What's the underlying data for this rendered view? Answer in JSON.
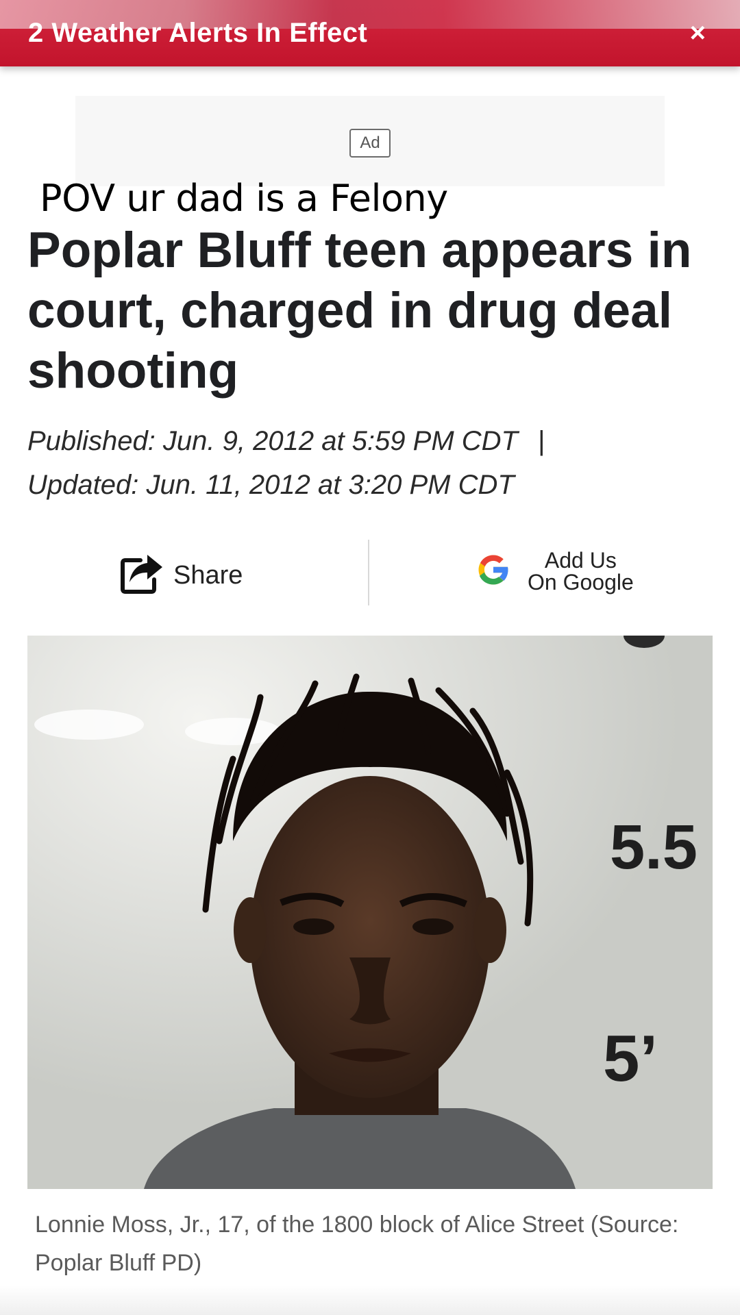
{
  "alert": {
    "text": "2 Weather Alerts In Effect",
    "close_label": "×"
  },
  "ad": {
    "label": "Ad"
  },
  "overlay_caption": "POV ur dad is a Felony",
  "article": {
    "headline": "Poplar Bluff teen appears in court, charged in drug deal shooting",
    "published": "Published: Jun. 9, 2012 at 5:59 PM CDT",
    "separator": "|",
    "updated": "Updated: Jun. 11, 2012 at 3:20 PM CDT"
  },
  "actions": {
    "share_label": "Share",
    "google_line1": "Add Us",
    "google_line2": "On Google"
  },
  "photo": {
    "wall_marking_top": "5.5",
    "wall_marking_bottom": "5’",
    "caption": "Lonnie Moss, Jr., 17, of the 1800 block of Alice Street (Source: Poplar Bluff PD)"
  },
  "colors": {
    "alert_red": "#c8182f",
    "headline": "#1f2023",
    "google_blue": "#4285F4",
    "google_red": "#EA4335",
    "google_yellow": "#FBBC05",
    "google_green": "#34A853"
  },
  "icons": [
    "share-icon",
    "google-logo-icon",
    "close-icon"
  ]
}
